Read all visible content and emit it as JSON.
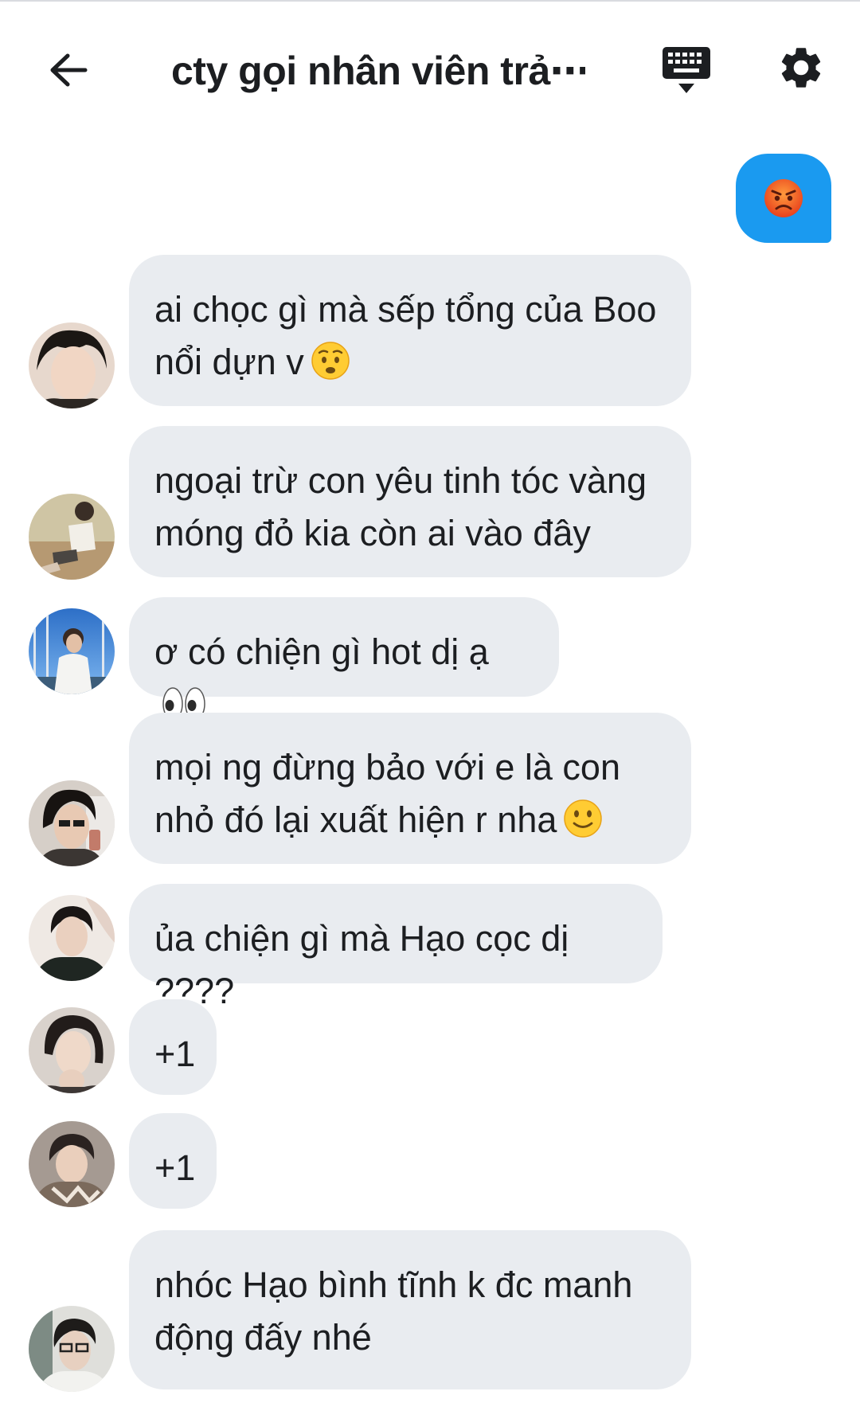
{
  "header": {
    "title": "cty gọi nhân viên trả⋯",
    "back_icon": "arrow-left-icon",
    "keyboard_icon": "keyboard-icon",
    "settings_icon": "gear-icon"
  },
  "colors": {
    "sent_bubble": "#1a9af0",
    "received_bubble": "#e9ecf0",
    "text": "#1c1e21"
  },
  "sent_message": {
    "emoji": "angry-face-emoji"
  },
  "messages": [
    {
      "text": "ai chọc gì mà sếp tổng của Boo\nnổi dựn v",
      "emoji": "anxious-face-emoji"
    },
    {
      "text": "ngoại trừ con yêu tinh tóc vàng\nmóng đỏ kia còn ai vào đây",
      "emoji": ""
    },
    {
      "text": "ơ có chiện gì hot dị ạ",
      "emoji": "eyes-emoji"
    },
    {
      "text": "mọi ng đừng bảo với e là con\nnhỏ đó lại xuất hiện r nha",
      "emoji": "slightly-smiling-face-emoji"
    },
    {
      "text": "ủa chiện gì mà Hạo cọc dị ????",
      "emoji": ""
    },
    {
      "text": "+1",
      "emoji": ""
    },
    {
      "text": "+1",
      "emoji": ""
    },
    {
      "text": "nhóc Hạo bình tĩnh k đc manh\nđộng đấy nhé",
      "emoji": ""
    }
  ]
}
